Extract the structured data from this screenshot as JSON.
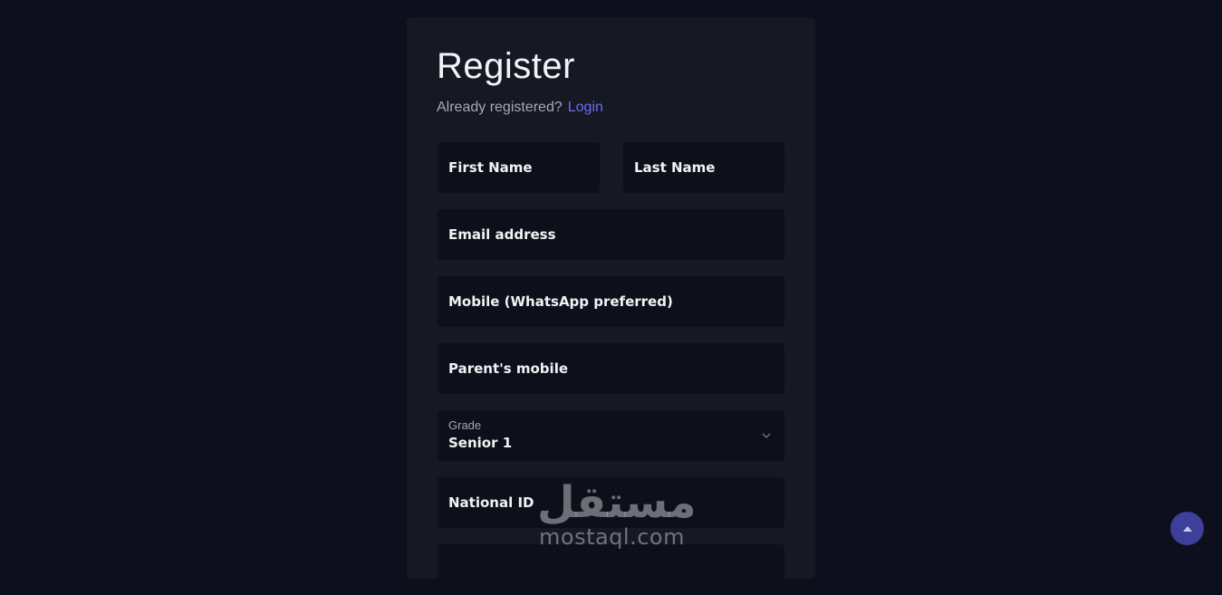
{
  "form": {
    "title": "Register",
    "already_registered": "Already registered?",
    "login_link": "Login",
    "fields": {
      "first_name": "First Name",
      "last_name": "Last Name",
      "email": "Email address",
      "mobile": "Mobile (WhatsApp preferred)",
      "parent_mobile": "Parent's mobile",
      "grade_label": "Grade",
      "grade_value": "Senior 1",
      "national_id": "National ID"
    }
  },
  "watermark": {
    "arabic": "مستقل",
    "latin": "mostaql.com"
  },
  "icons": {
    "grade_select": "chevron-down-icon",
    "scroll_top": "arrow-up-icon"
  },
  "colors": {
    "background": "#0d101c",
    "card": "#161824",
    "field": "#0d0f1a",
    "link": "#6d6cf0",
    "scroll_button": "#3d3f9a"
  }
}
